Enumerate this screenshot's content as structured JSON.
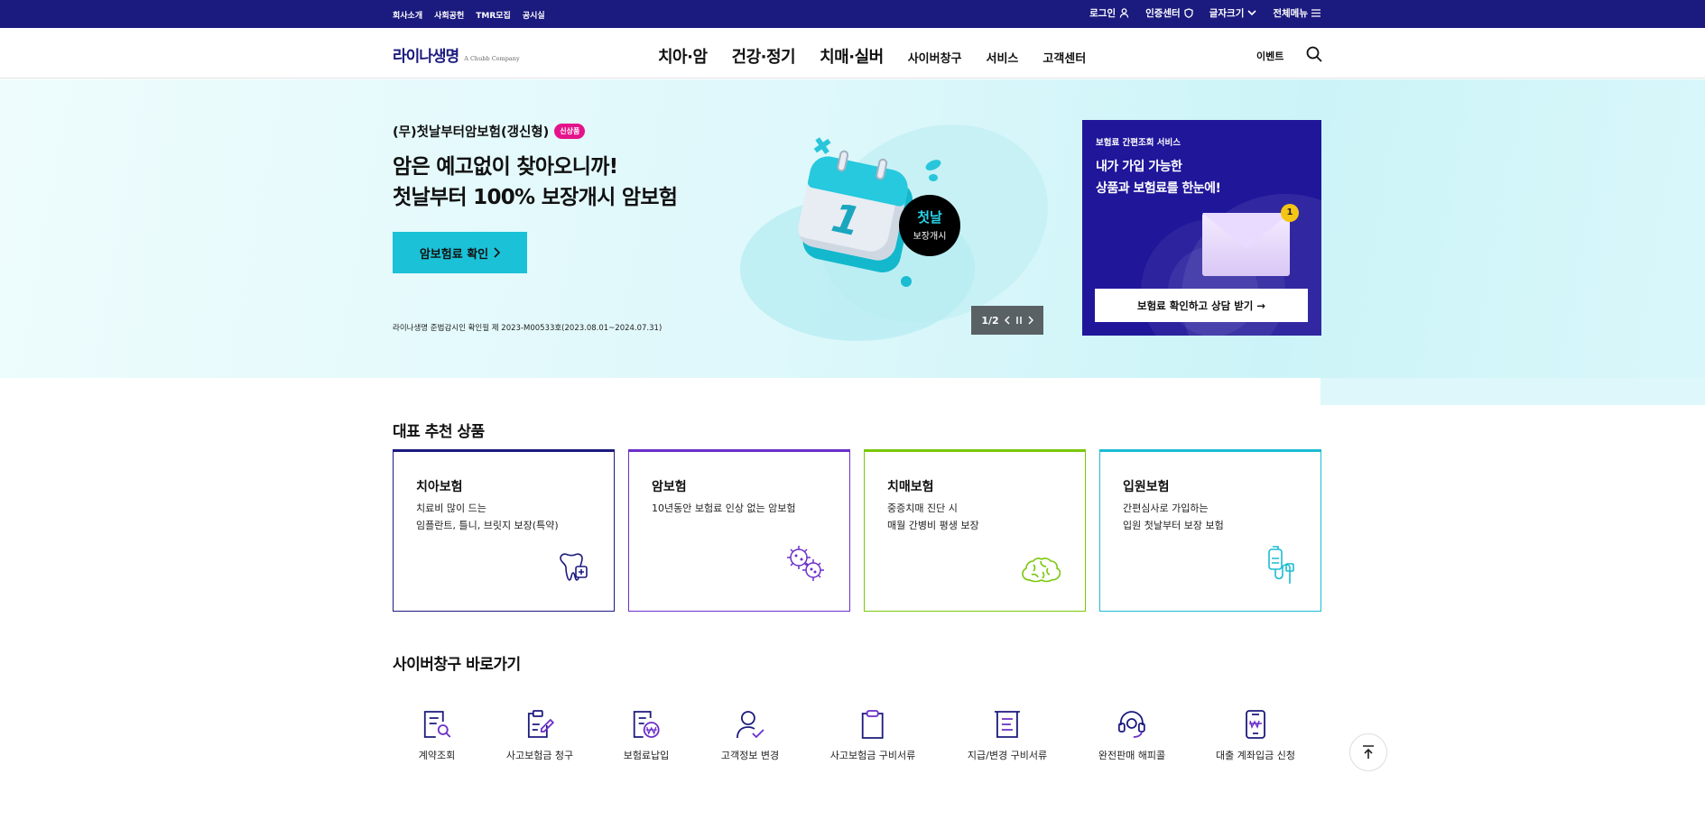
{
  "topbar": {
    "left_links": [
      "회사소개",
      "사회공헌",
      "TMR모집",
      "공시실"
    ],
    "login": "로그인",
    "cert": "인증센터",
    "font_size": "글자크기",
    "all_menu": "전체메뉴"
  },
  "header": {
    "logo": "라이나생명",
    "logo_sub": "A Chubb Company",
    "main_menu": [
      "치아·암",
      "건강·정기",
      "치매·실버"
    ],
    "sub_menu": [
      "사이버창구",
      "서비스",
      "고객센터"
    ],
    "event": "이벤트"
  },
  "hero": {
    "product_name": "(무)첫날부터암보험(갱신형)",
    "badge": "신상품",
    "headline_1": "암은 예고없이 찾아오니까!",
    "headline_2": "첫날부터 100% 보장개시 암보험",
    "cta": "암보험료 확인",
    "notice": "라이나생명 준법감시인 확인필 제 2023-M00533호(2023.08.01~2024.07.31)",
    "calendar_number": "1",
    "sticker_big": "첫날",
    "sticker_small": "보장개시",
    "pager": "1/2"
  },
  "promo": {
    "label": "보험료 간편조회 서비스",
    "title_1": "내가 가입 가능한",
    "title_2": "상품과 보험료를 한눈에!",
    "count": "1",
    "button": "보험료 확인하고 상담 받기 →"
  },
  "recommend": {
    "title": "대표 추천 상품",
    "cards": [
      {
        "title": "치아보험",
        "line1": "치료비 많이 드는",
        "line2": "임플란트, 틀니, 브릿지 보장(특약)",
        "color": "#1b1a7e",
        "icon": "tooth-icon"
      },
      {
        "title": "암보험",
        "line1": "10년동안 보험료 인상 없는 암보험",
        "line2": "",
        "color": "#6b2fc9",
        "icon": "virus-icon"
      },
      {
        "title": "치매보험",
        "line1": "중증치매 진단 시",
        "line2": "매월 간병비 평생 보장",
        "color": "#7ac70c",
        "icon": "brain-icon"
      },
      {
        "title": "입원보험",
        "line1": "간편심사로 가입하는",
        "line2": "입원 첫날부터 보장 보험",
        "color": "#1bbcd2",
        "icon": "iv-drip-icon"
      }
    ]
  },
  "cyber": {
    "title": "사이버창구 바로가기",
    "items": [
      {
        "label": "계약조회",
        "icon": "document-search-icon"
      },
      {
        "label": "사고보험금 청구",
        "icon": "clipboard-pen-icon"
      },
      {
        "label": "보험료납입",
        "icon": "won-payment-icon"
      },
      {
        "label": "고객정보 변경",
        "icon": "user-check-icon"
      },
      {
        "label": "사고보험금 구비서류",
        "icon": "clipboard-icon"
      },
      {
        "label": "지급/변경 구비서류",
        "icon": "document-list-icon"
      },
      {
        "label": "완전판매 해피콜",
        "icon": "headset-icon"
      },
      {
        "label": "대출 계좌입금 신청",
        "icon": "phone-won-icon"
      }
    ]
  },
  "colors": {
    "navy": "#1b1a7e",
    "accent": "#1bc1d7",
    "badge": "#e5138b"
  }
}
